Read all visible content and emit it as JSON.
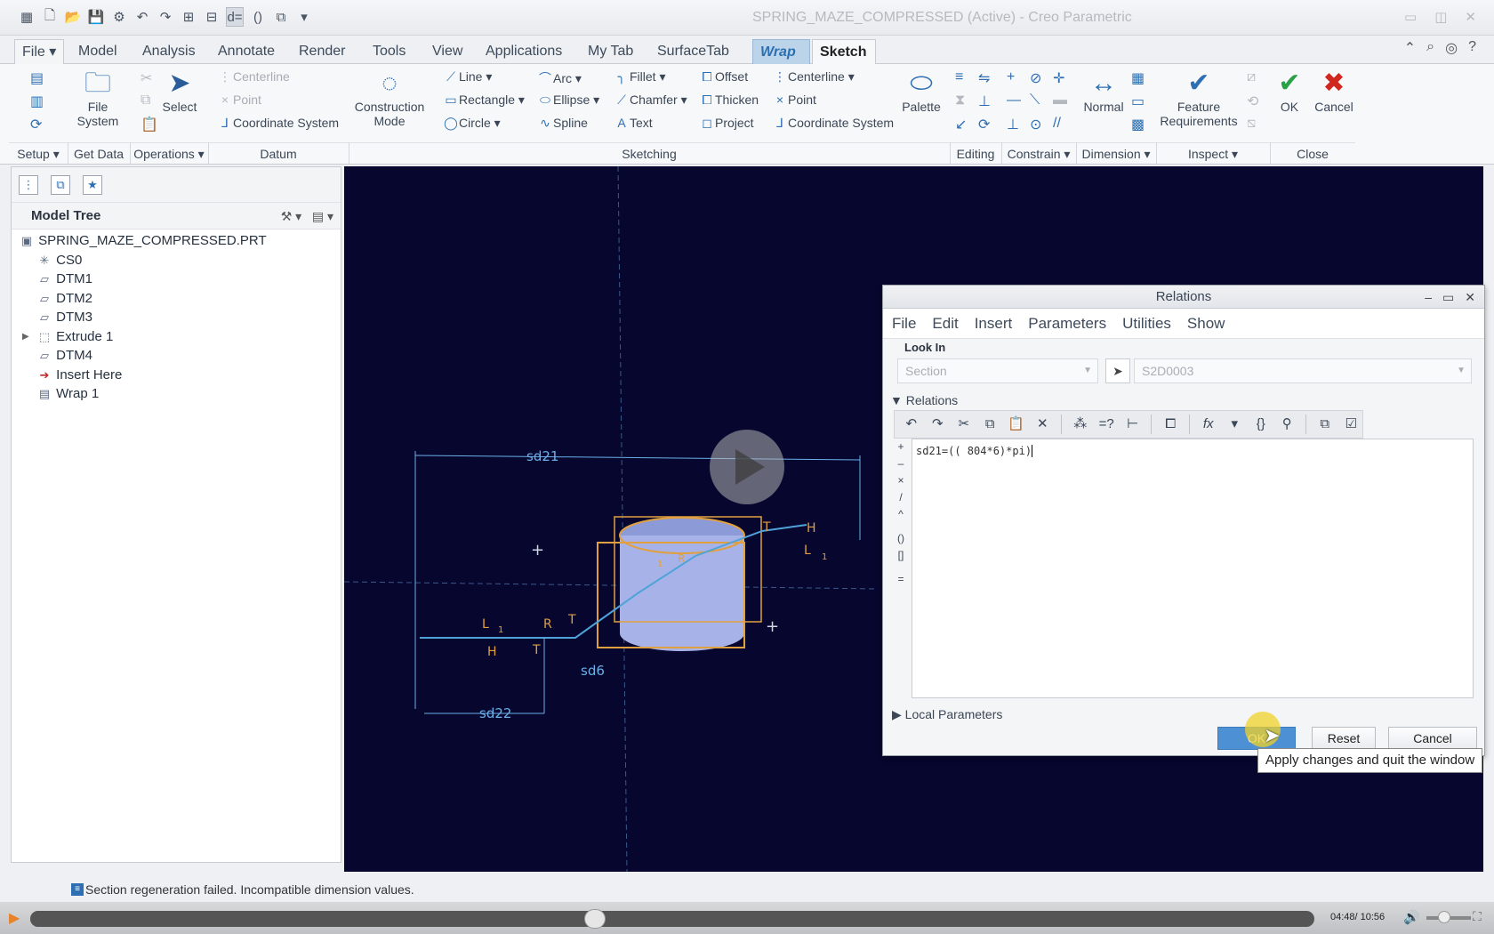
{
  "window": {
    "title": "SPRING_MAZE_COMPRESSED (Active) - Creo Parametric",
    "minimize": "▭",
    "restore": "◫",
    "close": "✕"
  },
  "quick_access": [
    "new-icon",
    "open-icon",
    "save-icon",
    "regenerate-icon",
    "undo-icon",
    "redo-icon",
    "relations-icon",
    "dimension-icon"
  ],
  "tabs": [
    {
      "label": "File",
      "type": "file"
    },
    {
      "label": "Model"
    },
    {
      "label": "Analysis"
    },
    {
      "label": "Annotate"
    },
    {
      "label": "Render"
    },
    {
      "label": "Tools"
    },
    {
      "label": "View"
    },
    {
      "label": "Applications"
    },
    {
      "label": "My Tab"
    },
    {
      "label": "SurfaceTab"
    },
    {
      "label": "Wrap",
      "type": "wrap"
    },
    {
      "label": "Sketch",
      "type": "sketch"
    }
  ],
  "ribbon": {
    "file_system": "File\nSystem",
    "select": "Select",
    "centerline1": "Centerline",
    "point1": "Point",
    "coord_sys1": "Coordinate System",
    "construction_mode": "Construction\nMode",
    "line": "Line",
    "rectangle": "Rectangle",
    "circle": "Circle",
    "arc": "Arc",
    "ellipse": "Ellipse",
    "spline": "Spline",
    "fillet": "Fillet",
    "chamfer": "Chamfer",
    "text": "Text",
    "offset": "Offset",
    "thicken": "Thicken",
    "project": "Project",
    "centerline2": "Centerline",
    "point2": "Point",
    "coord_sys2": "Coordinate System",
    "palette": "Palette",
    "normal": "Normal",
    "feature_req": "Feature\nRequirements",
    "ok": "OK",
    "cancel": "Cancel",
    "groups": {
      "setup": "Setup",
      "get_data": "Get Data",
      "operations": "Operations",
      "datum": "Datum",
      "sketching": "Sketching",
      "editing": "Editing",
      "constrain": "Constrain",
      "dimension": "Dimension",
      "inspect": "Inspect",
      "close": "Close"
    }
  },
  "model_tree": {
    "header": "Model Tree",
    "items": [
      {
        "label": "SPRING_MAZE_COMPRESSED.PRT",
        "icon": "part-icon",
        "glyph": "▣"
      },
      {
        "label": "CS0",
        "icon": "coord-system-icon",
        "glyph": "✳"
      },
      {
        "label": "DTM1",
        "icon": "datum-plane-icon",
        "glyph": "▱"
      },
      {
        "label": "DTM2",
        "icon": "datum-plane-icon",
        "glyph": "▱"
      },
      {
        "label": "DTM3",
        "icon": "datum-plane-icon",
        "glyph": "▱"
      },
      {
        "label": "Extrude 1",
        "icon": "extrude-icon",
        "glyph": "⬚"
      },
      {
        "label": "DTM4",
        "icon": "datum-plane-icon",
        "glyph": "▱"
      },
      {
        "label": "Insert Here",
        "icon": "insert-arrow-icon",
        "glyph": "➔"
      },
      {
        "label": "Wrap 1",
        "icon": "wrap-icon",
        "glyph": "▤"
      }
    ]
  },
  "sketch": {
    "dims": [
      "sd21",
      "sd22",
      "sd6",
      "T",
      "H",
      "L",
      "1",
      "R",
      "T",
      "L",
      "1",
      "H",
      "T",
      "R",
      "1"
    ]
  },
  "relations_dialog": {
    "title": "Relations",
    "menu": [
      "File",
      "Edit",
      "Insert",
      "Parameters",
      "Utilities",
      "Show"
    ],
    "look_in_label": "Look In",
    "look_in_section": "Section",
    "look_in_object": "S2D0003",
    "relations_label": "Relations",
    "editor_text": "sd21=(( 804*6)*pi)",
    "local_params_label": "Local Parameters",
    "ok": "OK",
    "reset": "Reset",
    "cancel": "Cancel",
    "tooltip": "Apply changes and quit the window"
  },
  "status": {
    "message": "Section regeneration failed.  Incompatible dimension values."
  },
  "player": {
    "time": "04:48/ 10:56",
    "progress": 0.44,
    "volume": 0.4
  }
}
